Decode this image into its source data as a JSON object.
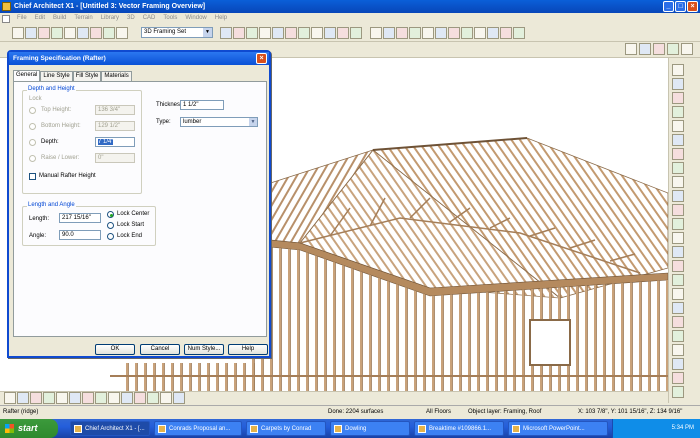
{
  "app": {
    "title": "Chief Architect X1 - [Untitled 3: Vector Framing Overview]"
  },
  "menu": [
    "File",
    "Edit",
    "Build",
    "Terrain",
    "Library",
    "3D",
    "CAD",
    "Tools",
    "Window",
    "Help"
  ],
  "toolbar": {
    "view_select": "3D Framing Set"
  },
  "dialog": {
    "title": "Framing Specification (Rafter)",
    "close": "×",
    "tabs": [
      "General",
      "Line Style",
      "Fill Style",
      "Materials"
    ],
    "depth_height": {
      "group_label": "Depth and Height",
      "lock_label": "Lock",
      "top_height_label": "Top Height:",
      "top_height_value": "136 3/4\"",
      "bottom_height_label": "Bottom Height:",
      "bottom_height_value": "129 1/2\"",
      "depth_label": "Depth:",
      "depth_value": "7 1/4\"",
      "raise_lower_label": "Raise / Lower:",
      "raise_lower_value": "0\"",
      "manual_label": "Manual Rafter Height"
    },
    "thickness_label": "Thickness:",
    "thickness_value": "1 1/2\"",
    "type_label": "Type:",
    "type_value": "lumber",
    "length_angle": {
      "group_label": "Length and Angle",
      "length_label": "Length:",
      "length_value": "217 15/16\"",
      "angle_label": "Angle:",
      "angle_value": "90.0",
      "lock_center": "Lock Center",
      "lock_start": "Lock Start",
      "lock_end": "Lock End"
    },
    "buttons": {
      "ok": "OK",
      "cancel": "Cancel",
      "num_style": "Num Style...",
      "help": "Help"
    }
  },
  "status": {
    "selection": "Rafter (ridge)",
    "done": "Done:  2204 surfaces",
    "floors": "All Floors",
    "layer": "Object layer: Framing, Roof",
    "coords": "X: 103 7/8\", Y: 101 15/16\", Z: 134 9/16\""
  },
  "taskbar": {
    "start": "start",
    "tasks": [
      "Chief Architect X1 - [...",
      "Conrads Proposal an...",
      "Carpets by Conrad",
      "Dowling",
      "Breaktime #109866.1...",
      "Microsoft PowerPoint..."
    ],
    "clock": "5:34 PM"
  },
  "colors": {
    "xp_blue": "#0a51d6",
    "lumber": "#c9a27a",
    "lumber_dark": "#8a6a48",
    "ok_green": "#21a121"
  }
}
